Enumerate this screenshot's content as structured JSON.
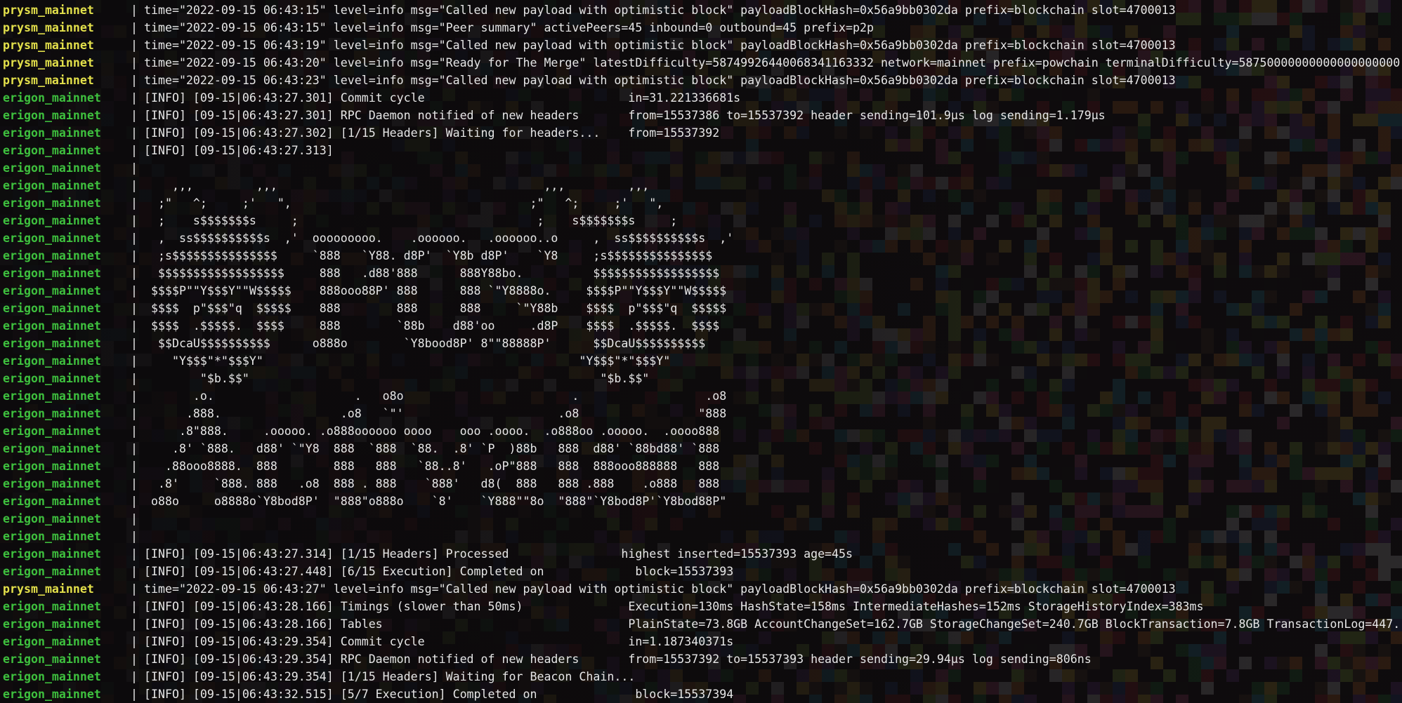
{
  "terminal": {
    "colors": {
      "prysm": "#e3e04b",
      "erigon": "#3ec03e",
      "text": "#e6e6e6",
      "background": "#100d0e"
    },
    "separator": "|",
    "lines": [
      {
        "service": "prysm_mainnet",
        "kind": "prysm",
        "text": "time=\"2022-09-15 06:43:15\" level=info msg=\"Called new payload with optimistic block\" payloadBlockHash=0x56a9bb0302da prefix=blockchain slot=4700013"
      },
      {
        "service": "prysm_mainnet",
        "kind": "prysm",
        "text": "time=\"2022-09-15 06:43:15\" level=info msg=\"Peer summary\" activePeers=45 inbound=0 outbound=45 prefix=p2p"
      },
      {
        "service": "prysm_mainnet",
        "kind": "prysm",
        "text": "time=\"2022-09-15 06:43:19\" level=info msg=\"Called new payload with optimistic block\" payloadBlockHash=0x56a9bb0302da prefix=blockchain slot=4700013"
      },
      {
        "service": "prysm_mainnet",
        "kind": "prysm",
        "text": "time=\"2022-09-15 06:43:20\" level=info msg=\"Ready for The Merge\" latestDifficulty=58749926440068341163332 network=mainnet prefix=powchain terminalDifficulty=58750000000000000000000"
      },
      {
        "service": "prysm_mainnet",
        "kind": "prysm",
        "text": "time=\"2022-09-15 06:43:23\" level=info msg=\"Called new payload with optimistic block\" payloadBlockHash=0x56a9bb0302da prefix=blockchain slot=4700013"
      },
      {
        "service": "erigon_mainnet",
        "kind": "erigon",
        "text": "[INFO] [09-15|06:43:27.301] Commit cycle                             in=31.221336681s"
      },
      {
        "service": "erigon_mainnet",
        "kind": "erigon",
        "text": "[INFO] [09-15|06:43:27.301] RPC Daemon notified of new headers       from=15537386 to=15537392 header sending=101.9µs log sending=1.179µs"
      },
      {
        "service": "erigon_mainnet",
        "kind": "erigon",
        "text": "[INFO] [09-15|06:43:27.302] [1/15 Headers] Waiting for headers...    from=15537392"
      },
      {
        "service": "erigon_mainnet",
        "kind": "erigon",
        "text": "[INFO] [09-15|06:43:27.313]"
      },
      {
        "service": "erigon_mainnet",
        "kind": "erigon",
        "text": ""
      },
      {
        "service": "erigon_mainnet",
        "kind": "erigon",
        "text": "    ,,,         ,,,                                      ,,,         ,,,"
      },
      {
        "service": "erigon_mainnet",
        "kind": "erigon",
        "text": "  ;\"   ^;     ;'   \",                                  ;\"   ^;     ;'   \","
      },
      {
        "service": "erigon_mainnet",
        "kind": "erigon",
        "text": "  ;    s$$$$$$$s     ;                                  ;    s$$$$$$$s     ;"
      },
      {
        "service": "erigon_mainnet",
        "kind": "erigon",
        "text": "  ,  ss$$$$$$$$$$s  ,'  ooooooooo.    .oooooo.   .oooooo..o     ,  ss$$$$$$$$$$s  ,'"
      },
      {
        "service": "erigon_mainnet",
        "kind": "erigon",
        "text": "  ;s$$$$$$$$$$$$$$$     `888   `Y88. d8P'  `Y8b d8P'    `Y8     ;s$$$$$$$$$$$$$$$"
      },
      {
        "service": "erigon_mainnet",
        "kind": "erigon",
        "text": "  $$$$$$$$$$$$$$$$$$     888   .d88'888      888Y88bo.          $$$$$$$$$$$$$$$$$$"
      },
      {
        "service": "erigon_mainnet",
        "kind": "erigon",
        "text": " $$$$P\"\"Y$$$Y\"\"W$$$$$    888ooo88P' 888      888 `\"Y8888o.     $$$$P\"\"Y$$$Y\"\"W$$$$$"
      },
      {
        "service": "erigon_mainnet",
        "kind": "erigon",
        "text": " $$$$  p\"$$$\"q  $$$$$    888        888      888     `\"Y88b    $$$$  p\"$$$\"q  $$$$$"
      },
      {
        "service": "erigon_mainnet",
        "kind": "erigon",
        "text": " $$$$  .$$$$$.  $$$$     888        `88b    d88'oo     .d8P    $$$$  .$$$$$.  $$$$"
      },
      {
        "service": "erigon_mainnet",
        "kind": "erigon",
        "text": "  $$DcaU$$$$$$$$$$      o888o        `Y8bood8P' 8\"\"88888P'      $$DcaU$$$$$$$$$$"
      },
      {
        "service": "erigon_mainnet",
        "kind": "erigon",
        "text": "    \"Y$$$\"*\"$$$Y\"                                             \"Y$$$\"*\"$$$Y\""
      },
      {
        "service": "erigon_mainnet",
        "kind": "erigon",
        "text": "        \"$b.$$\"                                                  \"$b.$$\""
      },
      {
        "service": "erigon_mainnet",
        "kind": "erigon",
        "text": "       .o.                    .   o8o                        .                  .o8"
      },
      {
        "service": "erigon_mainnet",
        "kind": "erigon",
        "text": "      .888.                 .o8   `\"'                      .o8                 \"888"
      },
      {
        "service": "erigon_mainnet",
        "kind": "erigon",
        "text": "     .8\"888.     .ooooo. .o888oooooo oooo    ooo .oooo.  .o888oo .ooooo.  .oooo888"
      },
      {
        "service": "erigon_mainnet",
        "kind": "erigon",
        "text": "    .8' `888.   d88' `\"Y8  888  `888  `88.  .8' `P  )88b   888  d88' `88bd88' `888"
      },
      {
        "service": "erigon_mainnet",
        "kind": "erigon",
        "text": "   .88ooo8888.  888        888   888   `88..8'   .oP\"888   888  888ooo888888   888"
      },
      {
        "service": "erigon_mainnet",
        "kind": "erigon",
        "text": "  .8'     `888. 888   .o8  888 . 888    `888'   d8(  888   888 .888    .o888   888"
      },
      {
        "service": "erigon_mainnet",
        "kind": "erigon",
        "text": " o88o     o8888o`Y8bod8P'  \"888\"o888o    `8'    `Y888\"\"8o  \"888\"`Y8bod8P'`Y8bod88P\""
      },
      {
        "service": "erigon_mainnet",
        "kind": "erigon",
        "text": ""
      },
      {
        "service": "erigon_mainnet",
        "kind": "erigon",
        "text": ""
      },
      {
        "service": "erigon_mainnet",
        "kind": "erigon",
        "text": "[INFO] [09-15|06:43:27.314] [1/15 Headers] Processed                highest inserted=15537393 age=45s"
      },
      {
        "service": "erigon_mainnet",
        "kind": "erigon",
        "text": "[INFO] [09-15|06:43:27.448] [6/15 Execution] Completed on             block=15537393"
      },
      {
        "service": "prysm_mainnet",
        "kind": "prysm",
        "text": "time=\"2022-09-15 06:43:27\" level=info msg=\"Called new payload with optimistic block\" payloadBlockHash=0x56a9bb0302da prefix=blockchain slot=4700013"
      },
      {
        "service": "erigon_mainnet",
        "kind": "erigon",
        "text": "[INFO] [09-15|06:43:28.166] Timings (slower than 50ms)               Execution=130ms HashState=158ms IntermediateHashes=152ms StorageHistoryIndex=383ms"
      },
      {
        "service": "erigon_mainnet",
        "kind": "erigon",
        "text": "[INFO] [09-15|06:43:28.166] Tables                                   PlainState=73.8GB AccountChangeSet=162.7GB StorageChangeSet=240.7GB BlockTransaction=7.8GB TransactionLog=447."
      },
      {
        "service": "erigon_mainnet",
        "kind": "erigon",
        "text": "[INFO] [09-15|06:43:29.354] Commit cycle                             in=1.187340371s"
      },
      {
        "service": "erigon_mainnet",
        "kind": "erigon",
        "text": "[INFO] [09-15|06:43:29.354] RPC Daemon notified of new headers       from=15537392 to=15537393 header sending=29.94µs log sending=806ns"
      },
      {
        "service": "erigon_mainnet",
        "kind": "erigon",
        "text": "[INFO] [09-15|06:43:29.354] [1/15 Headers] Waiting for Beacon Chain..."
      },
      {
        "service": "erigon_mainnet",
        "kind": "erigon",
        "text": "[INFO] [09-15|06:43:32.515] [5/7 Execution] Completed on              block=15537394"
      }
    ]
  }
}
